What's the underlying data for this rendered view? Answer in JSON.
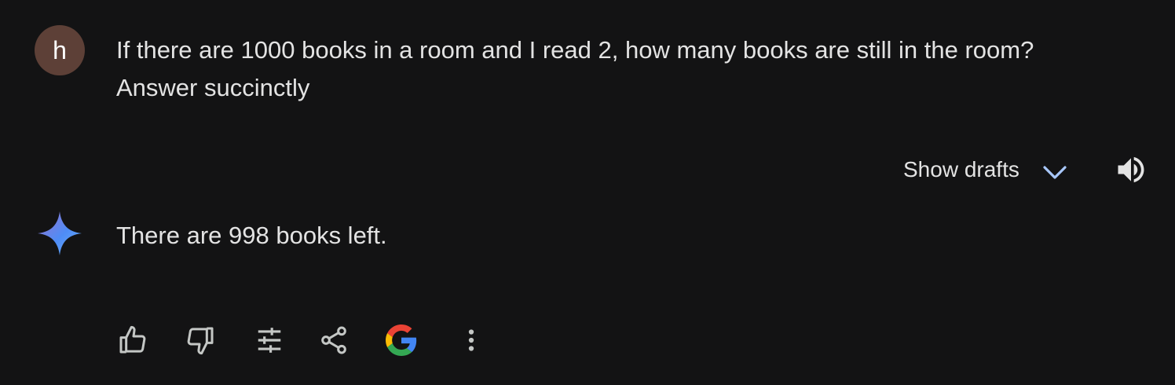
{
  "user": {
    "avatar_letter": "h",
    "avatar_color": "#5d4037",
    "prompt_line1": "If there are 1000 books in a room and I read 2, how many books are still in the room?",
    "prompt_line2": "Answer succinctly"
  },
  "response_header": {
    "show_drafts_label": "Show drafts",
    "chevron_icon": "chevron-down-icon",
    "speaker_icon": "volume-up-icon",
    "accent_color": "#a8c7fa"
  },
  "response": {
    "icon": "gemini-sparkle-icon",
    "text": "There are 998 books left."
  },
  "actions": [
    {
      "icon": "thumbs-up-icon"
    },
    {
      "icon": "thumbs-down-icon"
    },
    {
      "icon": "tune-icon"
    },
    {
      "icon": "share-icon"
    },
    {
      "icon": "google-icon"
    },
    {
      "icon": "more-vert-icon"
    }
  ]
}
